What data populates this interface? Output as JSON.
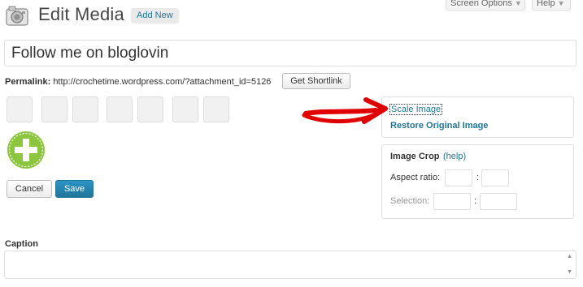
{
  "header": {
    "title": "Edit Media",
    "add_new": "Add New",
    "screen_options": "Screen Options",
    "help": "Help",
    "caret": "▼"
  },
  "title_field": {
    "value": "Follow me on bloglovin"
  },
  "permalink": {
    "label": "Permalink:",
    "url": "http://crochetime.wordpress.com/?attachment_id=5126",
    "shortlink_button": "Get Shortlink"
  },
  "editor": {
    "tools": [
      "crop-tool",
      "rotate-left-tool",
      "rotate-right-tool",
      "flip-vertical-tool",
      "flip-horizontal-tool",
      "undo-tool",
      "redo-tool"
    ],
    "cancel": "Cancel",
    "save": "Save"
  },
  "scale_panel": {
    "scale_image": "Scale Image",
    "restore_original": "Restore Original Image"
  },
  "crop_panel": {
    "title": "Image Crop",
    "help": "(help)",
    "aspect_ratio": "Aspect ratio:",
    "selection": "Selection:",
    "separator": ":"
  },
  "caption": {
    "label": "Caption"
  },
  "colors": {
    "link": "#21759b",
    "annotation": "#e00000",
    "placeholder_green": "#8cc63f"
  }
}
